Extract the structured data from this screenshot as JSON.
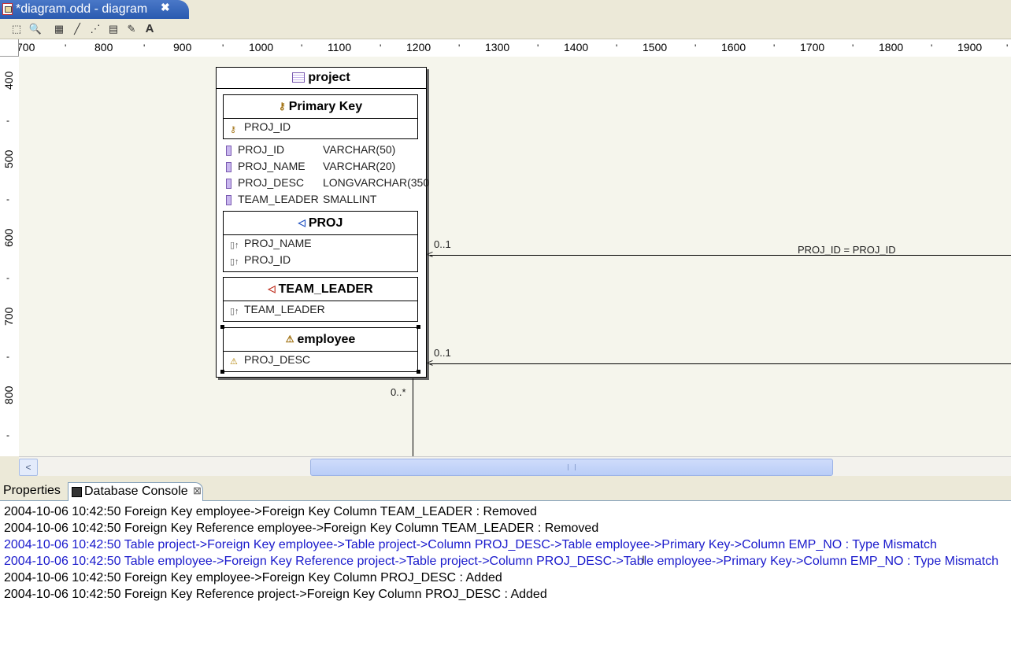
{
  "editor": {
    "tab_title": "*diagram.odd - diagram",
    "close_glyph": "✖"
  },
  "toolbar": {
    "tools": [
      {
        "name": "select-tool-icon",
        "glyph": "⬚"
      },
      {
        "name": "zoom-tool-icon",
        "glyph": "🔍"
      },
      {
        "name": "table-tool-icon",
        "glyph": "▦"
      },
      {
        "name": "connection-tool-icon",
        "glyph": "╱"
      },
      {
        "name": "dashed-connection-tool-icon",
        "glyph": "⋰"
      },
      {
        "name": "note-tool-icon",
        "glyph": "▤"
      },
      {
        "name": "note-link-tool-icon",
        "glyph": "✎"
      },
      {
        "name": "text-tool-icon",
        "glyph": "A"
      }
    ]
  },
  "ruler": {
    "horizontal": [
      "700",
      "800",
      "900",
      "1000",
      "1100",
      "1200",
      "1300",
      "1400",
      "1500",
      "1600",
      "1700",
      "1800",
      "1900"
    ],
    "vertical": [
      "400",
      "500",
      "600",
      "700",
      "800"
    ]
  },
  "diagram": {
    "table_name": "project",
    "primary_key": {
      "title": "Primary Key",
      "columns": [
        "PROJ_ID"
      ]
    },
    "columns": [
      {
        "name": "PROJ_ID",
        "type": "VARCHAR(50)"
      },
      {
        "name": "PROJ_NAME",
        "type": "VARCHAR(20)"
      },
      {
        "name": "PROJ_DESC",
        "type": "LONGVARCHAR(350"
      },
      {
        "name": "TEAM_LEADER",
        "type": "SMALLINT"
      }
    ],
    "foreign_keys": [
      {
        "title": "PROJ",
        "columns": [
          "PROJ_NAME",
          "PROJ_ID"
        ]
      },
      {
        "title": "TEAM_LEADER",
        "columns": [
          "TEAM_LEADER"
        ]
      },
      {
        "title": "employee",
        "columns": [
          "PROJ_DESC"
        ]
      }
    ],
    "relations": [
      {
        "cardinality": "0..1",
        "label": "PROJ_ID = PROJ_ID"
      },
      {
        "cardinality": "0..1",
        "label": ""
      },
      {
        "cardinality": "0..*",
        "label": ""
      }
    ]
  },
  "bottom_tabs": {
    "properties": "Properties",
    "console": "Database Console",
    "console_close": "⊠"
  },
  "console": {
    "lines": [
      {
        "text": "2004-10-06 10:42:50 Foreign Key employee->Foreign Key Column TEAM_LEADER : Removed",
        "color": "#000000"
      },
      {
        "text": "2004-10-06 10:42:50 Foreign Key Reference employee->Foreign Key Column TEAM_LEADER : Removed",
        "color": "#000000"
      },
      {
        "text": "2004-10-06 10:42:50 Table project->Foreign Key employee->Table project->Column PROJ_DESC->Table employee->Primary Key->Column EMP_NO : Type Mismatch",
        "color": "#1a1acc"
      },
      {
        "text": "2004-10-06 10:42:50 Table employee->Foreign Key Reference project->Table project->Column PROJ_DESC->Table employee->Primary Key->Column EMP_NO : Type Mismatch",
        "color": "#1a1acc"
      },
      {
        "text": "2004-10-06 10:42:50 Foreign Key employee->Foreign Key Column PROJ_DESC : Added",
        "color": "#000000"
      },
      {
        "text": "2004-10-06 10:42:50 Foreign Key Reference project->Foreign Key Column PROJ_DESC : Added",
        "color": "#000000"
      }
    ]
  }
}
